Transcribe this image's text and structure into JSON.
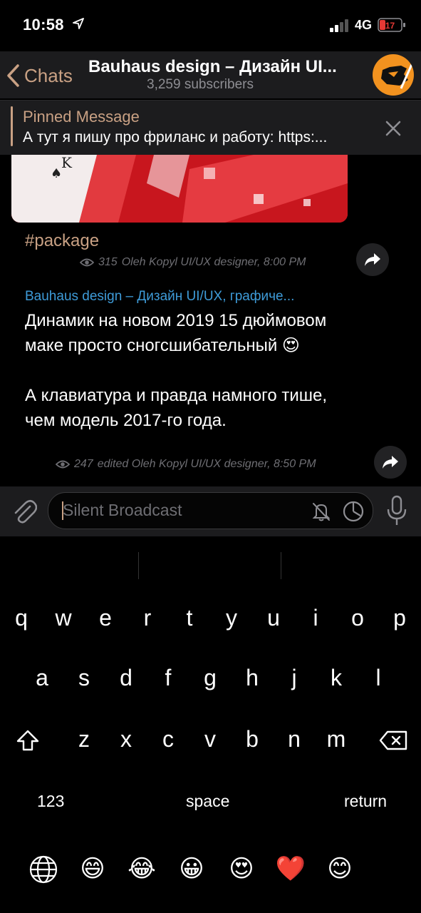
{
  "status_bar": {
    "time": "10:58",
    "network": "4G",
    "battery": "17"
  },
  "header": {
    "back_label": "Chats",
    "title": "Bauhaus design – Дизайн UI...",
    "subtitle": "3,259 subscribers"
  },
  "pinned": {
    "title": "Pinned Message",
    "text": "А тут я пишу про фриланс и работу:  https:..."
  },
  "messages": [
    {
      "hashtag": "#package",
      "views": "315",
      "footer": "Oleh Kopyl UI/UX designer, 8:00 PM"
    },
    {
      "author": "Bauhaus design – Дизайн UI/UX, графиче...",
      "text": "Динамик на новом 2019 15 дюймовом маке просто сногсшибательный 😍\n\nА клавиатура и правда намного тише, чем модель 2017-го года.",
      "views": "247",
      "footer": "edited Oleh Kopyl UI/UX designer, 8:50 PM"
    }
  ],
  "input": {
    "placeholder": "Silent Broadcast"
  },
  "keyboard": {
    "row1": [
      "q",
      "w",
      "e",
      "r",
      "t",
      "y",
      "u",
      "i",
      "o",
      "p"
    ],
    "row2": [
      "a",
      "s",
      "d",
      "f",
      "g",
      "h",
      "j",
      "k",
      "l"
    ],
    "row3": [
      "z",
      "x",
      "c",
      "v",
      "b",
      "n",
      "m"
    ],
    "numbers_label": "123",
    "space_label": "space",
    "return_label": "return",
    "emojis": [
      "😄",
      "😂",
      "😀",
      "😍",
      "❤️",
      "😊"
    ]
  },
  "colors": {
    "accent": "#c9a184",
    "link": "#3e9bd8",
    "bar": "#1c1c1e"
  }
}
